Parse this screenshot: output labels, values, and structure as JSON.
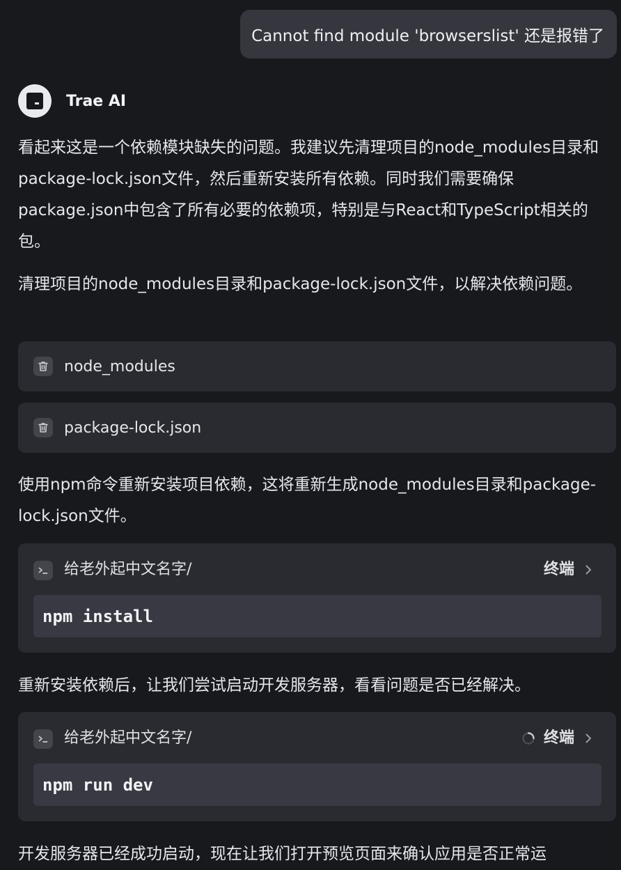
{
  "user_message": {
    "text": "Cannot find module 'browserslist' 还是报错了"
  },
  "assistant": {
    "name": "Trae AI",
    "intro": "看起来这是一个依赖模块缺失的问题。我建议先清理项目的node_modules目录和package-lock.json文件，然后重新安装所有依赖。同时我们需要确保package.json中包含了所有必要的依赖项，特别是与React和TypeScript相关的包。",
    "step1_text": "清理项目的node_modules目录和package-lock.json文件，以解决依赖问题。",
    "deleted_files": [
      {
        "name": "node_modules",
        "icon": "trash-icon"
      },
      {
        "name": "package-lock.json",
        "icon": "trash-icon"
      }
    ],
    "step2_text": "使用npm命令重新安装项目依赖，这将重新生成node_modules目录和package-lock.json文件。",
    "terminal1": {
      "path": "给老外起中文名字/",
      "link_label": "终端",
      "command": "npm install",
      "icon": "terminal-icon",
      "running": false
    },
    "step3_text": "重新安装依赖后，让我们尝试启动开发服务器，看看问题是否已经解决。",
    "terminal2": {
      "path": "给老外起中文名字/",
      "link_label": "终端",
      "command": "npm run dev",
      "icon": "terminal-icon",
      "running": true
    },
    "step4_text": "开发服务器已经成功启动，现在让我们打开预览页面来确认应用是否正常运"
  },
  "colors": {
    "background": "#18191d",
    "bubble": "#35363e",
    "card": "#2a2b31",
    "command_box": "#383942",
    "text": "#e6e7ea"
  }
}
